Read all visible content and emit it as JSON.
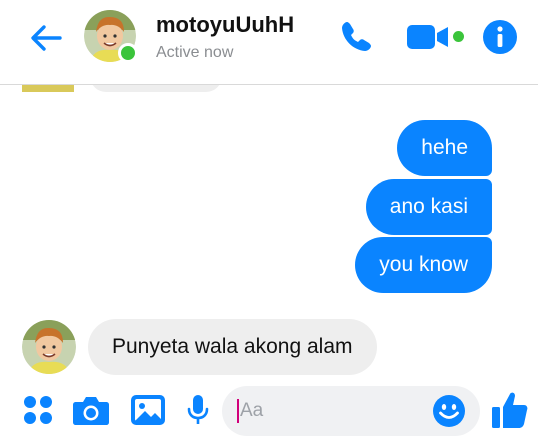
{
  "header": {
    "contact_name": "motoyuUuhH",
    "status": "Active now",
    "icons": [
      "back-arrow-icon",
      "phone-icon",
      "video-camera-icon",
      "info-icon"
    ]
  },
  "messages": [
    {
      "direction": "outgoing",
      "text": "hehe"
    },
    {
      "direction": "outgoing",
      "text": "ano kasi"
    },
    {
      "direction": "outgoing",
      "text": "you know"
    },
    {
      "direction": "incoming",
      "text": "Punyeta wala akong alam"
    }
  ],
  "composer": {
    "placeholder": "Aa",
    "icons": [
      "apps-icon",
      "camera-icon",
      "gallery-icon",
      "microphone-icon",
      "emoji-icon",
      "thumbs-up-icon"
    ]
  },
  "colors": {
    "accent": "#0a84ff",
    "active_green": "#3bc43b",
    "incoming_bubble": "#eeeeee",
    "input_background": "#f0f1f3",
    "caret": "#d1007a"
  }
}
